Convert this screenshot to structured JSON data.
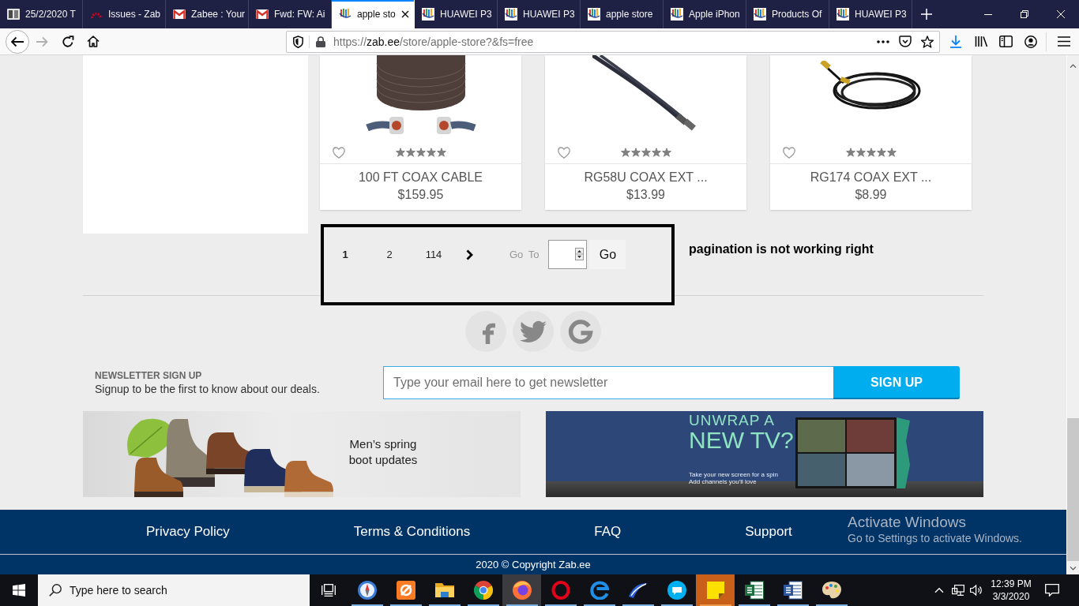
{
  "browser": {
    "tabs": [
      {
        "kind": "book",
        "title": "25/2/2020 T",
        "selected": false
      },
      {
        "kind": "arc",
        "title": "Issues - Zab",
        "selected": false
      },
      {
        "kind": "mail",
        "title": "Zabee : Your",
        "selected": false
      },
      {
        "kind": "mail",
        "title": "Fwd: FW: Ai",
        "selected": false
      },
      {
        "kind": "store",
        "title": "apple sto",
        "selected": true
      },
      {
        "kind": "store",
        "title": "HUAWEI P3",
        "selected": false
      },
      {
        "kind": "store",
        "title": "HUAWEI P3",
        "selected": false
      },
      {
        "kind": "store",
        "title": "apple store",
        "selected": false
      },
      {
        "kind": "store",
        "title": "Apple iPhon",
        "selected": false
      },
      {
        "kind": "store",
        "title": "Products Of",
        "selected": false
      },
      {
        "kind": "store",
        "title": "HUAWEI P3",
        "selected": false
      }
    ],
    "nav": [
      {
        "kind": "back",
        "disabled": false
      },
      {
        "kind": "forward",
        "disabled": true
      },
      {
        "kind": "reload",
        "disabled": false
      },
      {
        "kind": "home",
        "disabled": false
      }
    ],
    "address": {
      "scheme": "https://",
      "host": "zab.ee",
      "path": "/store/apple-store?&fs=free"
    }
  },
  "page": {
    "products": [
      {
        "kind": "coil",
        "name": "100 FT COAX CABLE",
        "price": "$159.95",
        "stars": 5
      },
      {
        "kind": "strand",
        "name": "RG58U COAX EXT ...",
        "price": "$13.99",
        "stars": 5
      },
      {
        "kind": "small-coil",
        "name": "RG174 COAX EXT ...",
        "price": "$8.99",
        "stars": 5
      }
    ],
    "pagination": {
      "pages": [
        {
          "label": "1",
          "selected": true
        },
        {
          "label": "2",
          "selected": false
        },
        {
          "label": "114",
          "selected": false
        }
      ],
      "goto_label": "Go To",
      "go_button": "Go"
    },
    "annotation": {
      "note": "pagination is not working right"
    },
    "social": [
      {
        "kind": "facebook"
      },
      {
        "kind": "twitter"
      },
      {
        "kind": "google"
      }
    ],
    "newsletter": {
      "heading": "NEWSLETTER SIGN UP",
      "text": "Signup to be the first to know about our deals.",
      "placeholder": "Type your email here to get newsletter",
      "button": "SIGN UP"
    },
    "banners": [
      {
        "kind": "boots",
        "caption": [
          "Men’s spring",
          "boot updates"
        ]
      },
      {
        "kind": "tv",
        "headline": "UNWRAP A",
        "headline_2": "NEW TV?",
        "tagline": [
          "Take your new screen for a spin",
          "Add channels you'll love"
        ]
      }
    ],
    "footer": {
      "links": [
        "Privacy Policy",
        "Terms & Conditions",
        "FAQ",
        "Support"
      ],
      "copyright": "2020 © Copyright Zab.ee"
    }
  },
  "os_notice": {
    "title": "Activate Windows",
    "text": "Go to Settings to activate Windows."
  },
  "taskbar": {
    "search": {
      "placeholder": "Type here to search"
    },
    "apps": [
      {
        "kind": "compass",
        "running": true,
        "selected": false,
        "flashing": false
      },
      {
        "kind": "xampp",
        "running": true,
        "selected": false,
        "flashing": false
      },
      {
        "kind": "files",
        "running": true,
        "selected": false,
        "flashing": false
      },
      {
        "kind": "chrome",
        "running": true,
        "selected": false,
        "flashing": false
      },
      {
        "kind": "firefox",
        "running": true,
        "selected": true,
        "flashing": false
      },
      {
        "kind": "opera",
        "running": true,
        "selected": false,
        "flashing": false
      },
      {
        "kind": "edge",
        "running": true,
        "selected": false,
        "flashing": false
      },
      {
        "kind": "swoosh",
        "running": true,
        "selected": false,
        "flashing": false
      },
      {
        "kind": "skype",
        "running": true,
        "selected": false,
        "flashing": false
      },
      {
        "kind": "sticky",
        "running": true,
        "selected": false,
        "flashing": true
      },
      {
        "kind": "excel",
        "running": true,
        "selected": false,
        "flashing": false
      },
      {
        "kind": "word",
        "running": true,
        "selected": false,
        "flashing": false
      },
      {
        "kind": "paint",
        "running": true,
        "selected": false,
        "flashing": false
      }
    ],
    "clock": {
      "time": "12:39 PM",
      "date": "3/3/2020"
    }
  }
}
